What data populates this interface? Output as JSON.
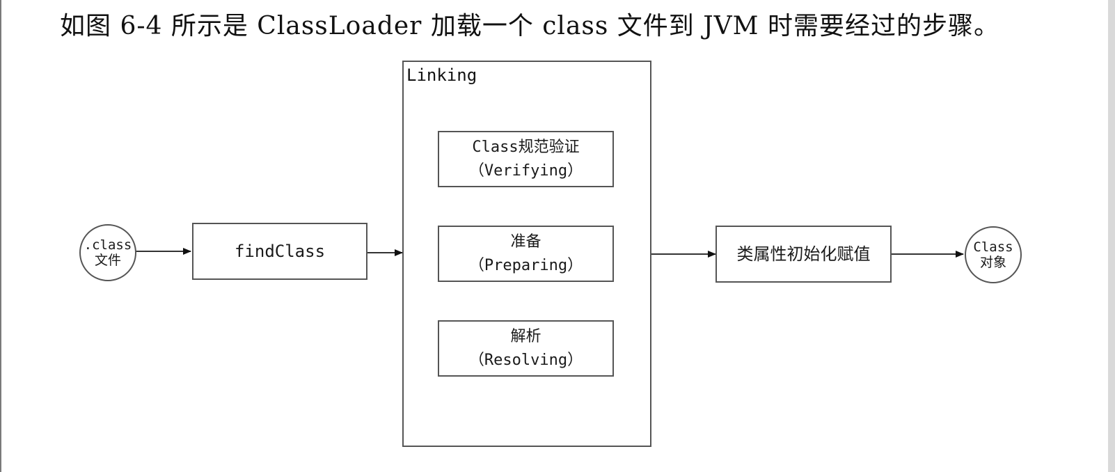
{
  "caption": "如图 6-4 所示是 ClassLoader 加载一个 class 文件到 JVM 时需要经过的步骤。",
  "nodes": {
    "class_file": {
      "line1": ".class",
      "line2": "文件"
    },
    "find_class": {
      "label": "findClass"
    },
    "linking": {
      "title": "Linking"
    },
    "verifying": {
      "line1": "Class规范验证",
      "line2": "（Verifying）"
    },
    "preparing": {
      "line1": "准备",
      "line2": "（Preparing）"
    },
    "resolving": {
      "line1": "解析",
      "line2": "（Resolving）"
    },
    "init": {
      "label": "类属性初始化赋值"
    },
    "class_object": {
      "line1": "Class",
      "line2": "对象"
    }
  }
}
